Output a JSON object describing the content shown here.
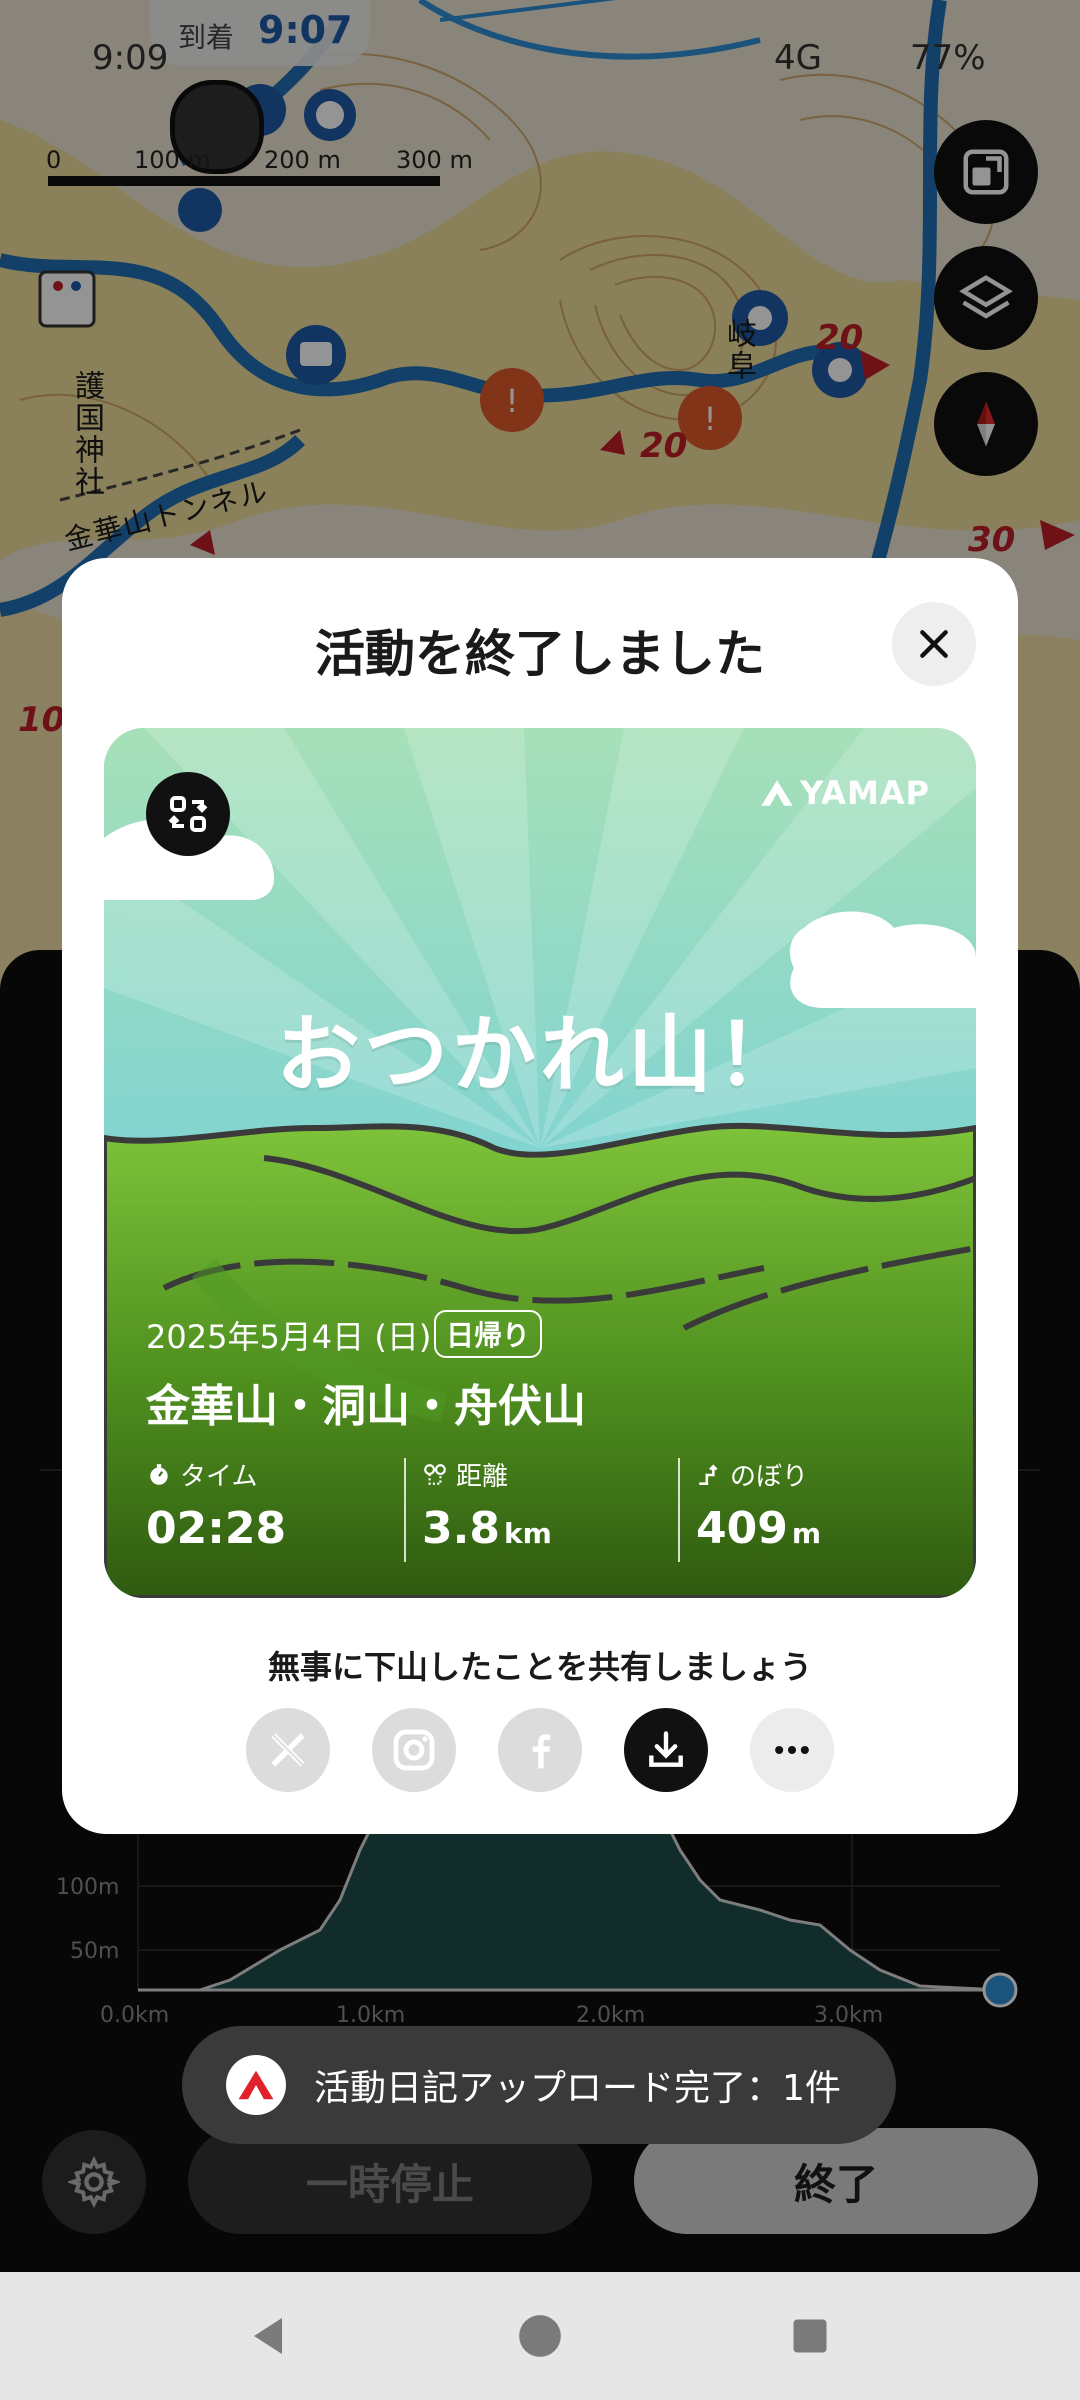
{
  "status_bar": {
    "time": "9:09",
    "arrival_label": "到着",
    "arrival_time": "9:07",
    "network": "4G",
    "battery": "77%"
  },
  "map": {
    "scale_labels": [
      "0",
      "100 m",
      "200 m",
      "300 m"
    ],
    "place_labels": [
      "護国神社",
      "金華山トンネル",
      "岐阜"
    ],
    "route_numbers": [
      "20",
      "20",
      "30",
      "10"
    ],
    "buttons": [
      "fullscreen-icon",
      "layers-icon",
      "compass-icon"
    ]
  },
  "modal": {
    "title": "活動を終了しました",
    "card": {
      "logo": "YAMAP",
      "headline": "おつかれ山！",
      "date": "2025年5月4日 (日)",
      "badge": "日帰り",
      "route": "金華山・洞山・舟伏山",
      "stats": [
        {
          "label": "タイム",
          "value": "02:28",
          "unit": ""
        },
        {
          "label": "距離",
          "value": "3.8",
          "unit": "km"
        },
        {
          "label": "のぼり",
          "value": "409",
          "unit": "m"
        }
      ]
    },
    "share_text": "無事に下山したことを共有しましょう",
    "share_buttons": [
      "x-icon",
      "instagram-icon",
      "facebook-icon",
      "download-icon",
      "more-icon"
    ]
  },
  "elevation_chart": {
    "y_ticks": [
      "100m",
      "50m"
    ],
    "x_ticks": [
      "0.0km",
      "1.0km",
      "2.0km",
      "3.0km"
    ]
  },
  "toast": {
    "text": "活動日記アップロード完了：1件"
  },
  "controls": {
    "pause_label": "一時停止",
    "end_label": "終了"
  }
}
